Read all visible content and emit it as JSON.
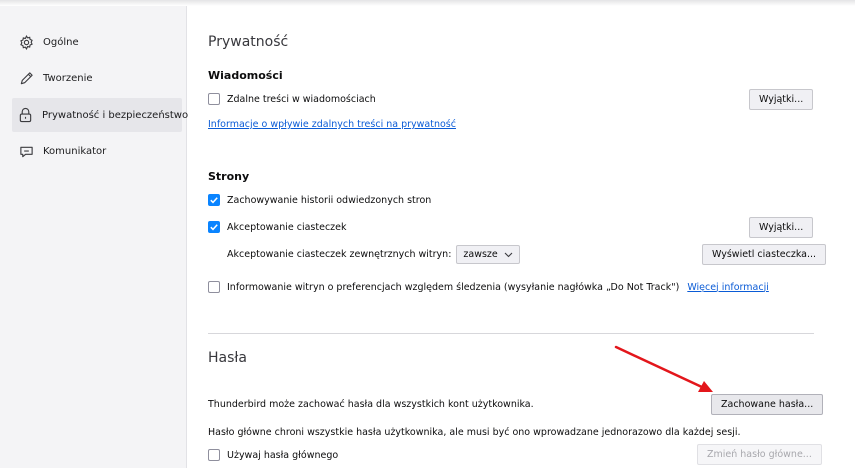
{
  "sidebar": {
    "items": [
      {
        "label": "Ogólne",
        "icon": "gear-icon",
        "selected": false
      },
      {
        "label": "Tworzenie",
        "icon": "pencil-icon",
        "selected": false
      },
      {
        "label": "Prywatność i bezpieczeństwo",
        "icon": "lock-icon",
        "selected": true
      },
      {
        "label": "Komunikator",
        "icon": "chat-bubble-icon",
        "selected": false
      }
    ]
  },
  "privacy": {
    "title": "Prywatność",
    "messages": {
      "heading": "Wiadomości",
      "remote_content_label": "Zdalne treści w wiadomościach",
      "remote_content_checked": false,
      "exceptions_button": "Wyjątki...",
      "info_link": "Informacje o wpływie zdalnych treści na prywatność"
    },
    "sites": {
      "heading": "Strony",
      "history_label": "Zachowywanie historii odwiedzonych stron",
      "history_checked": true,
      "cookies_label": "Akceptowanie ciasteczek",
      "cookies_checked": true,
      "exceptions_button": "Wyjątki...",
      "third_party_label": "Akceptowanie ciasteczek zewnętrznych witryn:",
      "third_party_value": "zawsze",
      "show_cookies_button": "Wyświetl ciasteczka...",
      "dnt_label": "Informowanie witryn o preferencjach względem śledzenia (wysyłanie nagłówka „Do Not Track\")",
      "dnt_checked": false,
      "more_info_link": "Więcej informacji"
    }
  },
  "passwords": {
    "title": "Hasła",
    "description": "Thunderbird może zachować hasła dla wszystkich kont użytkownika.",
    "saved_button": "Zachowane hasła...",
    "master_description": "Hasło główne chroni wszystkie hasła użytkownika, ale musi być ono wprowadzane jednorazowo dla każdej sesji.",
    "use_master_label": "Używaj hasła głównego",
    "use_master_checked": false,
    "change_master_button": "Zmień hasło główne..."
  },
  "colors": {
    "accent": "#0a84ff",
    "link": "#0a5bd6",
    "annotation_arrow": "#e3161b"
  }
}
